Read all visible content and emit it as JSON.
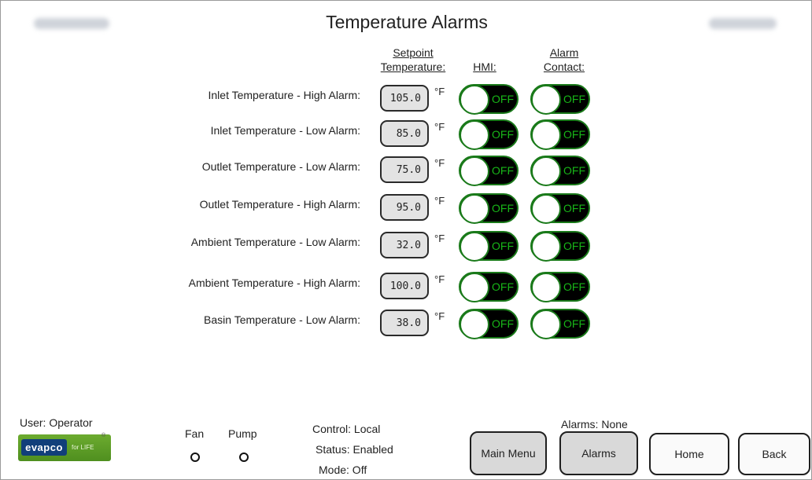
{
  "header": {
    "title": "Temperature Alarms"
  },
  "columns": {
    "setpoint_line1": "Setpoint",
    "setpoint_line2": "Temperature:",
    "hmi": "HMI:",
    "alarm_line1": "Alarm",
    "alarm_line2": "Contact:"
  },
  "alarms": [
    {
      "label": "Inlet Temperature - High Alarm:",
      "setpoint": "105.0",
      "unit": "°F",
      "hmi": "OFF",
      "contact": "OFF"
    },
    {
      "label": "Inlet Temperature - Low Alarm:",
      "setpoint": "85.0",
      "unit": "°F",
      "hmi": "OFF",
      "contact": "OFF"
    },
    {
      "label": "Outlet Temperature - Low Alarm:",
      "setpoint": "75.0",
      "unit": "°F",
      "hmi": "OFF",
      "contact": "OFF"
    },
    {
      "label": "Outlet Temperature - High Alarm:",
      "setpoint": "95.0",
      "unit": "°F",
      "hmi": "OFF",
      "contact": "OFF"
    },
    {
      "label": "Ambient Temperature - Low Alarm:",
      "setpoint": "32.0",
      "unit": "°F",
      "hmi": "OFF",
      "contact": "OFF"
    },
    {
      "label": "Ambient Temperature - High Alarm:",
      "setpoint": "100.0",
      "unit": "°F",
      "hmi": "OFF",
      "contact": "OFF"
    },
    {
      "label": "Basin Temperature - Low Alarm:",
      "setpoint": "38.0",
      "unit": "°F",
      "hmi": "OFF",
      "contact": "OFF"
    }
  ],
  "footer": {
    "user": "User: Operator",
    "logo_text": "evapco",
    "logo_tagline": "for LIFE",
    "logo_tm": "®",
    "fan_label": "Fan",
    "pump_label": "Pump",
    "control": "Control: Local",
    "status": "Status: Enabled",
    "mode": "Mode:  Off",
    "alarms_status": "Alarms: None",
    "buttons": {
      "main_menu": "Main Menu",
      "alarms": "Alarms",
      "home": "Home",
      "back": "Back"
    }
  },
  "colors": {
    "toggle_background": "#000000",
    "toggle_border": "#1a7a1a",
    "toggle_text": "#18b618",
    "button_fill": "#d9d9d9",
    "logo_green": "#6cab2f",
    "logo_blue": "#113f7a"
  },
  "icons": {
    "fan_indicator": "circle-outline-icon",
    "pump_indicator": "circle-outline-icon"
  }
}
